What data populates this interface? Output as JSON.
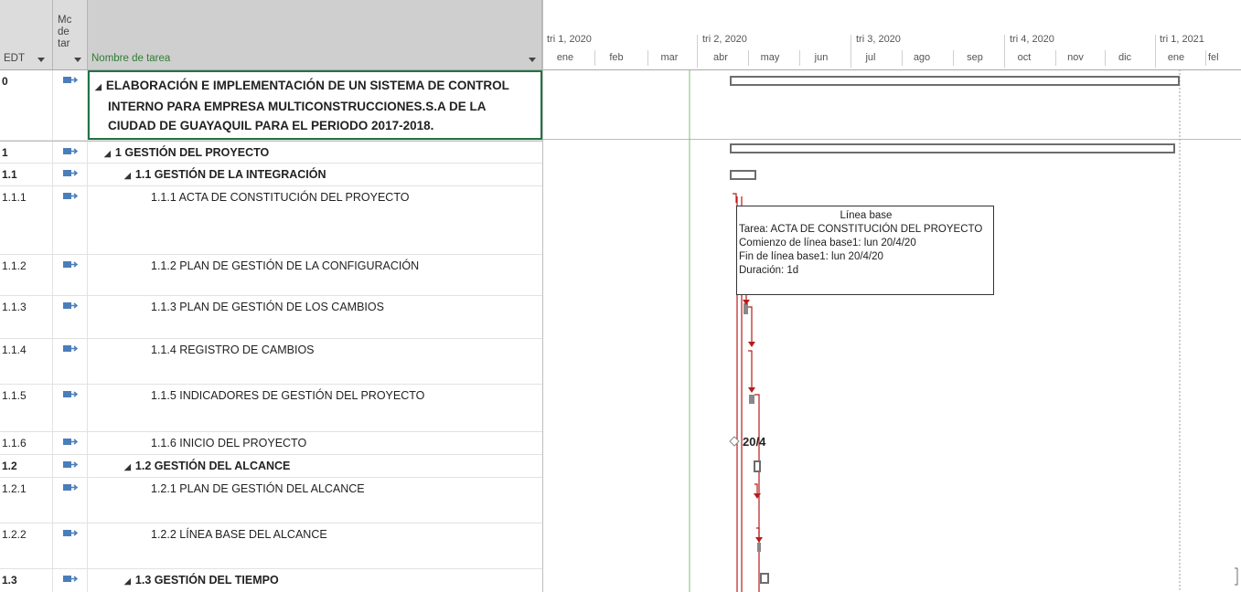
{
  "grid": {
    "headers": {
      "edt": "EDT",
      "mode_line1": "Mc",
      "mode_line2": "de",
      "mode_line3": "tar",
      "name": "Nombre de tarea"
    },
    "rows": [
      {
        "edt": "0",
        "name_lines": [
          "ELABORACIÓN E IMPLEMENTACIÓN DE UN SISTEMA DE CONTROL",
          "INTERNO PARA EMPRESA MULTICONSTRUCCIONES.S.A DE LA",
          "CIUDAD DE GUAYAQUIL PARA EL PERIODO 2017-2018."
        ]
      },
      {
        "edt": "1",
        "name": "1 GESTIÓN DEL PROYECTO"
      },
      {
        "edt": "1.1",
        "name": "1.1 GESTIÓN DE LA INTEGRACIÓN"
      },
      {
        "edt": "1.1.1",
        "name": "1.1.1 ACTA DE CONSTITUCIÓN DEL PROYECTO"
      },
      {
        "edt": "1.1.2",
        "name": "1.1.2 PLAN DE GESTIÓN DE LA CONFIGURACIÓN"
      },
      {
        "edt": "1.1.3",
        "name": "1.1.3 PLAN DE GESTIÓN DE LOS CAMBIOS"
      },
      {
        "edt": "1.1.4",
        "name": "1.1.4 REGISTRO DE CAMBIOS"
      },
      {
        "edt": "1.1.5",
        "name": "1.1.5 INDICADORES DE GESTIÓN DEL PROYECTO"
      },
      {
        "edt": "1.1.6",
        "name": "1.1.6 INICIO DEL PROYECTO"
      },
      {
        "edt": "1.2",
        "name": "1.2 GESTIÓN DEL ALCANCE"
      },
      {
        "edt": "1.2.1",
        "name": "1.2.1 PLAN DE GESTIÓN DEL ALCANCE"
      },
      {
        "edt": "1.2.2",
        "name": "1.2.2 LÍNEA BASE DEL ALCANCE"
      },
      {
        "edt": "1.3",
        "name": "1.3 GESTIÓN DEL TIEMPO"
      }
    ]
  },
  "timeline": {
    "quarters": [
      "tri 1, 2020",
      "tri 2, 2020",
      "tri 3, 2020",
      "tri 4, 2020",
      "tri 1, 2021"
    ],
    "months": [
      "ene",
      "feb",
      "mar",
      "abr",
      "may",
      "jun",
      "jul",
      "ago",
      "sep",
      "oct",
      "nov",
      "dic",
      "ene",
      "fel"
    ]
  },
  "tooltip": {
    "title": "Línea base",
    "task": "Tarea: ACTA DE CONSTITUCIÓN DEL PROYECTO",
    "start": "Comienzo de línea base1: lun 20/4/20",
    "end": "Fin de línea base1: lun 20/4/20",
    "duration": "Duración: 1d"
  },
  "milestone_label": "20/4",
  "colors": {
    "link": "#b71c1c",
    "summary_bar": "#6d6d6d",
    "selection": "#217346",
    "today_line": "#7fbf7f"
  }
}
